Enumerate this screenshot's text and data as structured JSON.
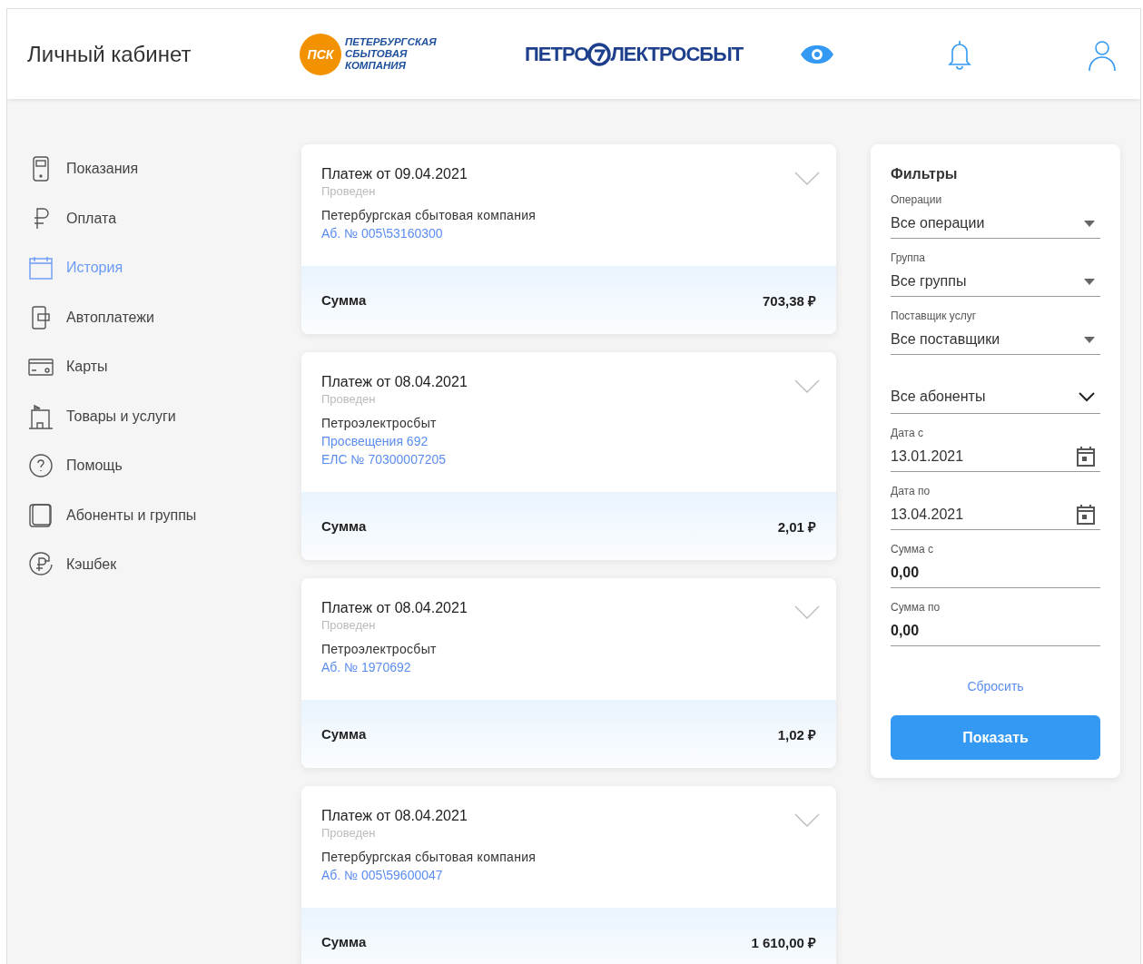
{
  "header": {
    "title": "Личный кабинет",
    "logos": [
      {
        "kind": "psk",
        "badge": "ПСК",
        "lines": [
          "ПЕТЕРБУРГСКАЯ",
          "СБЫТОВАЯ",
          "КОМПАНИЯ"
        ]
      },
      {
        "kind": "pes",
        "left": "ПЕТРО",
        "right": "ЛЕКТРОСБЫТ"
      }
    ]
  },
  "sidebar": {
    "items": [
      {
        "label": "Показания",
        "kind": "meter",
        "selected": false
      },
      {
        "label": "Оплата",
        "kind": "ruble",
        "selected": false
      },
      {
        "label": "История",
        "kind": "calendar",
        "selected": true
      },
      {
        "label": "Автоплатежи",
        "kind": "phone",
        "selected": false
      },
      {
        "label": "Карты",
        "kind": "card",
        "selected": false
      },
      {
        "label": "Товары и услуги",
        "kind": "shop",
        "selected": false
      },
      {
        "label": "Помощь",
        "kind": "help",
        "selected": false
      },
      {
        "label": "Абоненты и группы",
        "kind": "stack",
        "selected": false
      },
      {
        "label": "Кэшбек",
        "kind": "cashback",
        "selected": false
      }
    ]
  },
  "payments": [
    {
      "title": "Платеж от 09.04.2021",
      "status": "Проведен",
      "provider": "Петербургская сбытовая компания",
      "details": [
        "Аб. № 005\\53160300"
      ],
      "sum_label": "Сумма",
      "sum": "703,38 ₽"
    },
    {
      "title": "Платеж от 08.04.2021",
      "status": "Проведен",
      "provider": "Петроэлектросбыт",
      "details": [
        "Просвещения 692",
        "ЕЛС № 70300007205"
      ],
      "sum_label": "Сумма",
      "sum": "2,01 ₽"
    },
    {
      "title": "Платеж от 08.04.2021",
      "status": "Проведен",
      "provider": "Петроэлектросбыт",
      "details": [
        "Аб. № 1970692"
      ],
      "sum_label": "Сумма",
      "sum": "1,02 ₽"
    },
    {
      "title": "Платеж от 08.04.2021",
      "status": "Проведен",
      "provider": "Петербургская сбытовая компания",
      "details": [
        "Аб. № 005\\59600047"
      ],
      "sum_label": "Сумма",
      "sum": "1 610,00 ₽"
    }
  ],
  "filters": {
    "title": "Фильтры",
    "fields": [
      {
        "kind": "select",
        "label": "Операции",
        "value": "Все операции"
      },
      {
        "kind": "select",
        "label": "Группа",
        "value": "Все группы"
      },
      {
        "kind": "select",
        "label": "Поставщик услуг",
        "value": "Все поставщики"
      },
      {
        "kind": "dropdown",
        "value": "Все абоненты"
      },
      {
        "kind": "date",
        "label": "Дата с",
        "value": "13.01.2021"
      },
      {
        "kind": "date",
        "label": "Дата по",
        "value": "13.04.2021"
      },
      {
        "kind": "amount",
        "label": "Сумма с",
        "value": "0,00"
      },
      {
        "kind": "amount",
        "label": "Сумма по",
        "value": "0,00"
      }
    ],
    "reset": "Сбросить",
    "submit": "Показать"
  }
}
